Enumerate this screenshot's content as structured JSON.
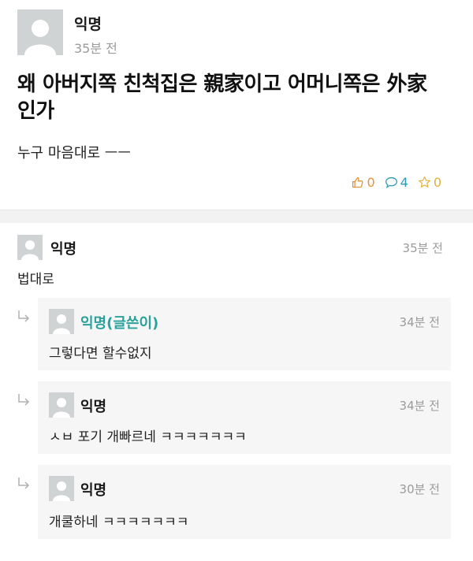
{
  "post": {
    "author": "익명",
    "time": "35분 전",
    "title": "왜 아버지쪽 친척집은 親家이고 어머니쪽은 外家인가",
    "body": "누구 마음대로 ㅡㅡ",
    "stats": {
      "likes": "0",
      "comments": "4",
      "scraps": "0"
    }
  },
  "comments": [
    {
      "author": "익명",
      "time": "35분 전",
      "text": "법대로"
    }
  ],
  "replies": [
    {
      "author": "익명(글쓴이)",
      "time": "34분 전",
      "text": "그렇다면 할수없지"
    },
    {
      "author": "익명",
      "time": "34분 전",
      "text": "ㅅㅂ 포기 개빠르네 ㅋㅋㅋㅋㅋㅋㅋ"
    },
    {
      "author": "익명",
      "time": "30분 전",
      "text": "개쿨하네 ㅋㅋㅋㅋㅋㅋㅋ"
    }
  ],
  "colors": {
    "op_author": "#2aa19a",
    "like": "#e0913c",
    "comment": "#2a9bb5",
    "scrap": "#e0b23c"
  },
  "icons": [
    "avatar-icon",
    "thumbs-up-icon",
    "speech-bubble-icon",
    "star-icon",
    "reply-arrow-icon"
  ]
}
